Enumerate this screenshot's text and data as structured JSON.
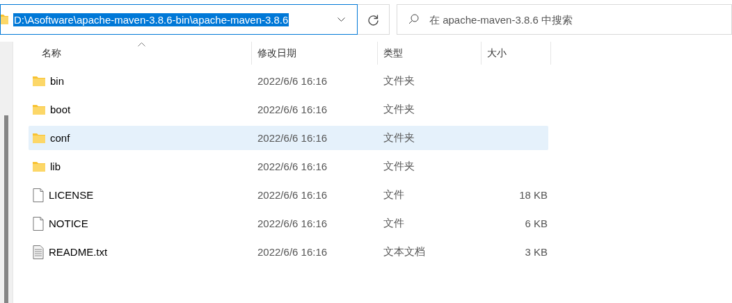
{
  "address_bar": {
    "value": "D:\\Asoftware\\apache-maven-3.8.6-bin\\apache-maven-3.8.6",
    "text_selected": true
  },
  "search": {
    "placeholder": "在 apache-maven-3.8.6 中搜索"
  },
  "table": {
    "columns": [
      {
        "label": "名称",
        "sorted": true
      },
      {
        "label": "修改日期",
        "sorted": false
      },
      {
        "label": "类型",
        "sorted": false
      },
      {
        "label": "大小",
        "sorted": false
      }
    ],
    "rows": [
      {
        "kind": "folder",
        "name": "bin",
        "modified": "2022/6/6 16:16",
        "type": "文件夹",
        "selected": false
      },
      {
        "kind": "folder",
        "name": "boot",
        "modified": "2022/6/6 16:16",
        "type": "文件夹",
        "selected": false
      },
      {
        "kind": "folder",
        "name": "conf",
        "modified": "2022/6/6 16:16",
        "type": "文件夹",
        "selected": true
      },
      {
        "kind": "folder",
        "name": "lib",
        "modified": "2022/6/6 16:16",
        "type": "文件夹",
        "selected": false
      },
      {
        "kind": "file",
        "name": "LICENSE",
        "modified": "2022/6/6 16:16",
        "type": "文件",
        "size": "18 KB",
        "selected": false
      },
      {
        "kind": "file",
        "name": "NOTICE",
        "modified": "2022/6/6 16:16",
        "type": "文件",
        "size": "6 KB",
        "selected": false
      },
      {
        "kind": "text",
        "name": "README.txt",
        "modified": "2022/6/6 16:16",
        "type": "文本文档",
        "size": "3 KB",
        "selected": false
      }
    ]
  }
}
